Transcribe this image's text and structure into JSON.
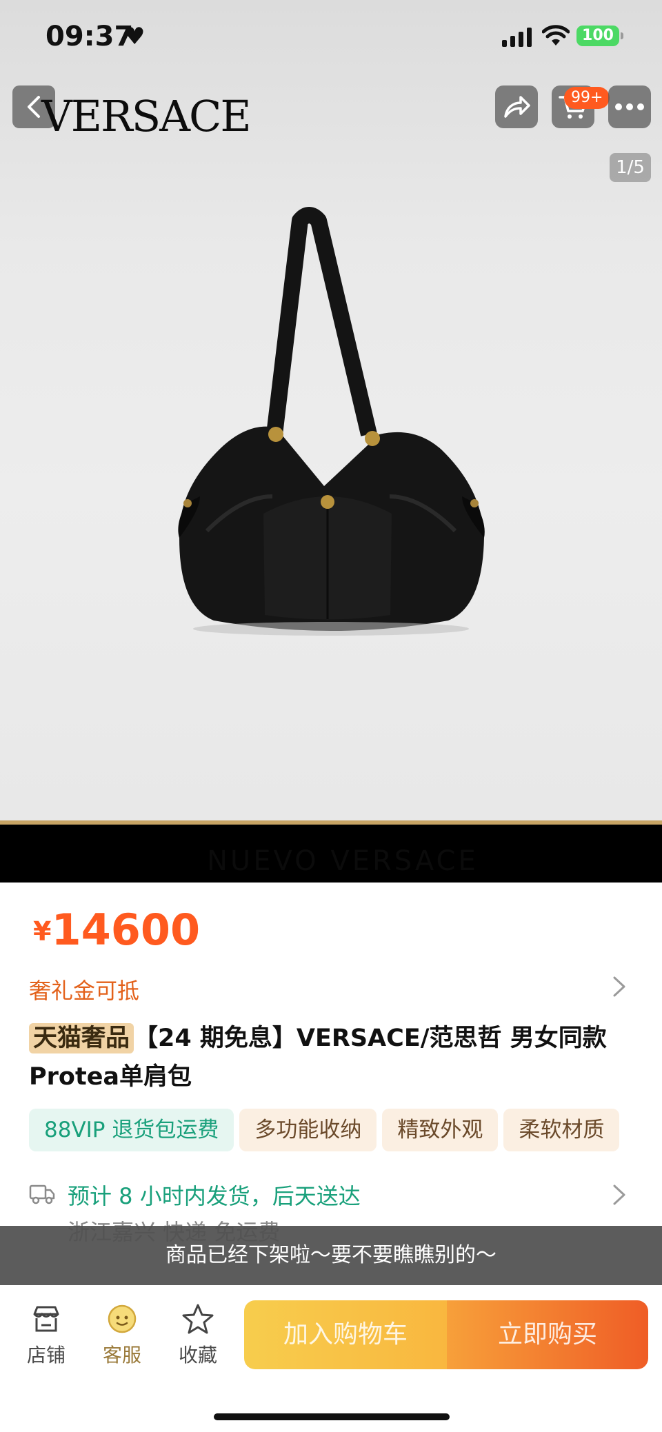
{
  "status_bar": {
    "time": "09:37",
    "battery": "100",
    "icons": [
      "heart-icon",
      "signal-icon",
      "wifi-icon",
      "battery-icon"
    ]
  },
  "nav": {
    "brand": "VERSACE",
    "cart_badge": "99+",
    "page_indicator": "1/5",
    "icons": [
      "back-arrow-icon",
      "share-icon",
      "cart-icon",
      "more-icon"
    ]
  },
  "hero": {
    "band_text": "NUEVO VERSACE"
  },
  "price": {
    "currency": "¥",
    "amount": "14600"
  },
  "promo": {
    "label": "奢礼金可抵"
  },
  "title": {
    "tag": "天猫奢品",
    "text": "【24 期免息】VERSACE/范思哲 男女同款 Protea单肩包"
  },
  "chips": [
    {
      "label": "88VIP 退货包运费",
      "kind": "vip"
    },
    {
      "label": "多功能收纳",
      "kind": "feature"
    },
    {
      "label": "精致外观",
      "kind": "feature"
    },
    {
      "label": "柔软材质",
      "kind": "feature"
    }
  ],
  "shipping": {
    "main": "预计 8 小时内发货，后天送达",
    "sub": "浙江嘉兴  快递  免运费"
  },
  "toast": {
    "text": "商品已经下架啦～要不要瞧瞧别的～"
  },
  "bottom": {
    "tabs": [
      {
        "label": "店铺",
        "icon": "store-icon"
      },
      {
        "label": "客服",
        "icon": "customer-service-icon"
      },
      {
        "label": "收藏",
        "icon": "star-icon"
      }
    ],
    "add_to_cart": "加入购物车",
    "buy_now": "立即购买"
  },
  "colors": {
    "accent_orange": "#ff5a1f",
    "promo_orange": "#e3611a",
    "vip_green": "#19a07b",
    "tag_gold": "#f1d3a5",
    "cart_btn_yellow": "#f7cd4d",
    "buy_btn_orange": "#ef5d26"
  }
}
